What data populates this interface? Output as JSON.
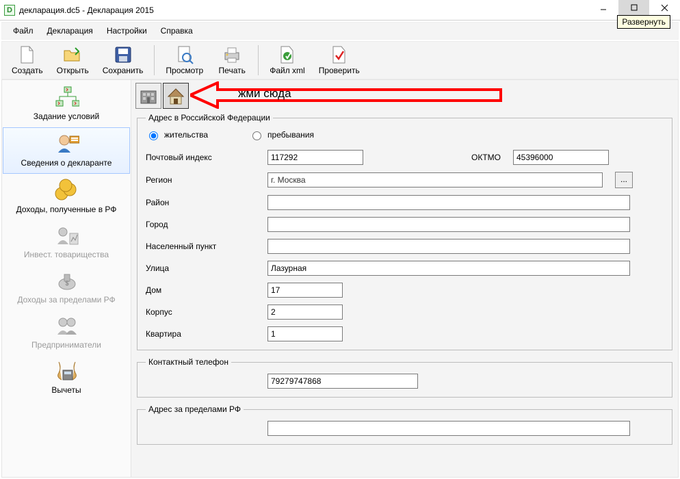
{
  "window": {
    "title": "декларация.dc5 - Декларация 2015",
    "tooltip_maximize": "Развернуть"
  },
  "menu": {
    "file": "Файл",
    "declaration": "Декларация",
    "settings": "Настройки",
    "help": "Справка"
  },
  "toolbar": {
    "create": "Создать",
    "open": "Открыть",
    "save": "Сохранить",
    "preview": "Просмотр",
    "print": "Печать",
    "file_xml": "Файл xml",
    "check": "Проверить"
  },
  "sidebar": {
    "conditions": "Задание условий",
    "declarant": "Сведения о декларанте",
    "income_rf": "Доходы, полученные в РФ",
    "invest": "Инвест. товарищества",
    "foreign_income": "Доходы за пределами РФ",
    "entrepreneurs": "Предприниматели",
    "deductions": "Вычеты"
  },
  "annotation": {
    "text": "жми сюда"
  },
  "form": {
    "group_rf_title": "Адрес в Российской Федерации",
    "radio_residence": "жительства",
    "radio_stay": "пребывания",
    "postal_label": "Почтовый индекс",
    "postal_value": "117292",
    "oktmo_label": "ОКТМО",
    "oktmo_value": "45396000",
    "region_label": "Регион",
    "region_value": "г. Москва",
    "district_label": "Район",
    "district_value": "",
    "city_label": "Город",
    "city_value": "",
    "settlement_label": "Населенный пункт",
    "settlement_value": "",
    "street_label": "Улица",
    "street_value": "Лазурная",
    "house_label": "Дом",
    "house_value": "17",
    "building_label": "Корпус",
    "building_value": "2",
    "flat_label": "Квартира",
    "flat_value": "1",
    "group_phone_title": "Контактный телефон",
    "phone_value": "79279747868",
    "group_foreign_title": "Адрес за пределами РФ",
    "foreign_value": ""
  }
}
